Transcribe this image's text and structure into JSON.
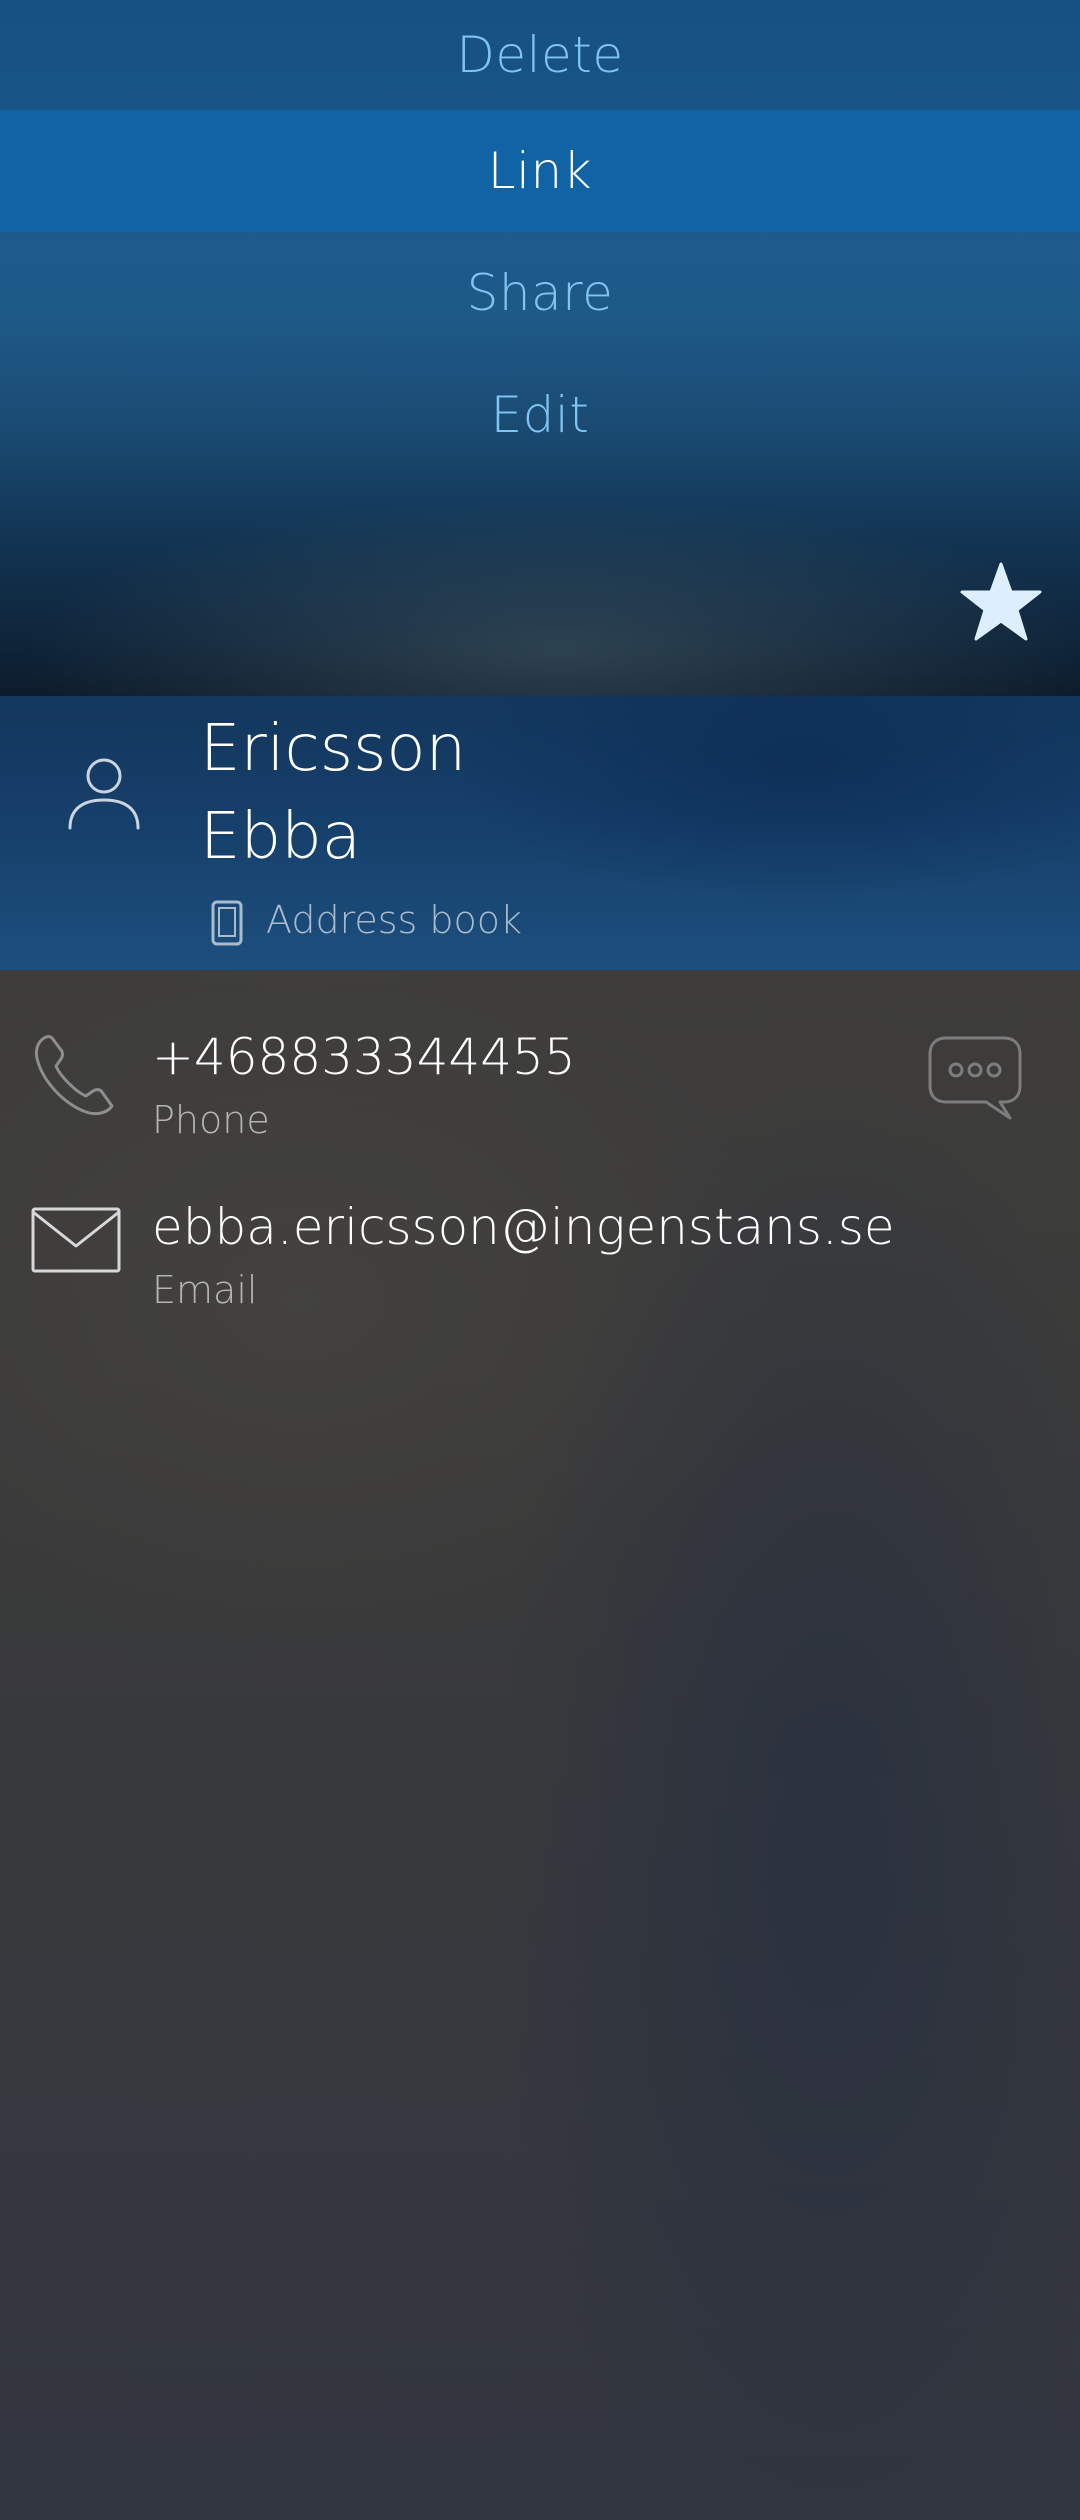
{
  "menu": {
    "items": [
      {
        "id": "delete",
        "label": "Delete"
      },
      {
        "id": "link",
        "label": "Link"
      },
      {
        "id": "share",
        "label": "Share"
      },
      {
        "id": "edit",
        "label": "Edit"
      }
    ],
    "highlighted": "Link"
  },
  "contact": {
    "last_name": "Ericsson",
    "first_name": "Ebba",
    "source": "Address book",
    "favorite": true
  },
  "details": {
    "phone": {
      "value": "+468833344455",
      "type": "Phone"
    },
    "email": {
      "value": "ebba.ericsson@ingenstans.se",
      "type": "Email"
    }
  },
  "icons": {
    "favorite": "star-icon",
    "avatar": "person-icon",
    "source": "phone-device-icon",
    "phone": "phone-icon",
    "message": "message-bubble-icon",
    "email": "envelope-icon"
  },
  "colors": {
    "menu_text": "#7fc4f2",
    "highlight_bg": "#1064a5",
    "header_bg": "#163f6a",
    "primary_text": "#ffffff",
    "secondary_text": "#b5b5b5"
  }
}
